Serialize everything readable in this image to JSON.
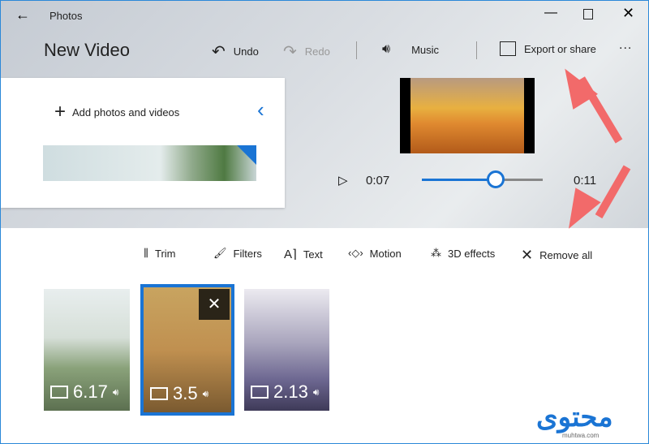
{
  "window": {
    "title": "Photos",
    "project_title": "New Video"
  },
  "toolbar": {
    "undo": "Undo",
    "redo": "Redo",
    "music": "Music",
    "export": "Export or share",
    "more": "..."
  },
  "library": {
    "add_label": "Add photos and videos"
  },
  "player": {
    "current_time": "0:07",
    "total_time": "0:11",
    "progress_fraction": 0.62
  },
  "tools": {
    "trim": "Trim",
    "filters": "Filters",
    "text": "Text",
    "motion": "Motion",
    "effects": "3D effects",
    "remove_all": "Remove all"
  },
  "storyboard": {
    "clips": [
      {
        "duration": "6.17",
        "selected": false
      },
      {
        "duration": "3.5",
        "selected": true
      },
      {
        "duration": "2.13",
        "selected": false
      }
    ]
  },
  "colors": {
    "accent": "#1a74d4",
    "annotation_arrow": "#f26a6a"
  },
  "watermark": {
    "logo_text": "محتوى",
    "site": "muhtwa.com"
  }
}
